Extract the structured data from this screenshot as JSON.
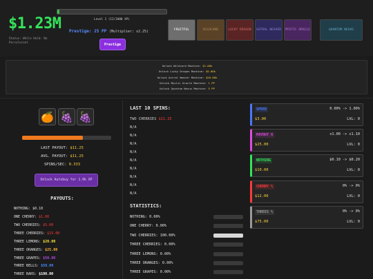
{
  "header": {
    "money": "$1.23M",
    "status": "Status: While Hold: No Parcolorant",
    "xp_fraction": 0.02,
    "level_label": "Level 1 (12/1000 XP)",
    "prestige_label": "Prestige: 25 PP",
    "prestige_mult": "(Multiplier: x2.25)",
    "prestige_button": "Prestige"
  },
  "tabs": [
    {
      "label": "FRUITFUL",
      "bg": "#6e6e6e",
      "fg": "#ffffff"
    },
    {
      "label": "WILDCARD",
      "bg": "#5a4226",
      "fg": "#b08a5a"
    },
    {
      "label": "LUCKY DRAGON",
      "bg": "#5a2424",
      "fg": "#d06a6a"
    },
    {
      "label": "ASTRAL WEAVER",
      "bg": "#2e2a5e",
      "fg": "#8a86d6"
    },
    {
      "label": "MYSTIC ORACLE",
      "bg": "#4a2660",
      "fg": "#b57ad6"
    },
    {
      "label": "QUANTUM NEXUS",
      "bg": "#1f3e4a",
      "fg": "#6aa8c0"
    }
  ],
  "unlocks": [
    {
      "text": "Unlock Wildcard Machine: ",
      "cost": "$1.00k"
    },
    {
      "text": "Unlock Lucky Dragon Machine: ",
      "cost": "$5.00k"
    },
    {
      "text": "Unlock Astral Weaver Machine: ",
      "cost": "$20.00k"
    },
    {
      "text": "Unlock Mystic Oracle Machine: ",
      "cost": "1 PP"
    },
    {
      "text": "Unlock Quantum Nexus Machine: ",
      "cost": "5 PP"
    }
  ],
  "reels": [
    "🍊",
    "🍇",
    "🍇"
  ],
  "spin_progress": 0.68,
  "stats": {
    "last_payout_label": "LAST PAYOUT: ",
    "last_payout": "$11.25",
    "avg_payout_label": "AVG. PAYOUT: ",
    "avg_payout": "$11.25",
    "spins_label": "SPINS/SEC: ",
    "spins": "0.333"
  },
  "autobuy_button": "Unlock Autobuy for 1.0k XP",
  "payouts": {
    "title": "PAYOUTS:",
    "rows": [
      {
        "label": "NOTHING: ",
        "value": "$0.10",
        "color": "#e6e6e6"
      },
      {
        "label": "ONE CHERRY: ",
        "value": "$1.00",
        "color": "#ff3b3b"
      },
      {
        "label": "TWO CHERRIES: ",
        "value": "$5.00",
        "color": "#ff3b3b"
      },
      {
        "label": "THREE CHERRIES: ",
        "value": "$15.00",
        "color": "#ff3b3b"
      },
      {
        "label": "THREE LEMONS: ",
        "value": "$20.00",
        "color": "#ffe63a"
      },
      {
        "label": "THREE ORANGES: ",
        "value": "$25.00",
        "color": "#ffb43a"
      },
      {
        "label": "THREE GRAPES: ",
        "value": "$50.00",
        "color": "#b24ae0"
      },
      {
        "label": "THREE BELLS: ",
        "value": "$50.00",
        "color": "#4a8cff"
      },
      {
        "label": "THREE BARS: ",
        "value": "$100.00",
        "color": "#ffffff"
      }
    ]
  },
  "last_spins": {
    "title": "LAST 10 SPINS:",
    "first_label": "TWO CHERRIES ",
    "first_value": "$11.25",
    "rest": [
      "N/A",
      "N/A",
      "N/A",
      "N/A",
      "N/A",
      "N/A",
      "N/A",
      "N/A",
      "N/A"
    ]
  },
  "statistics": {
    "title": "STATISTICS:",
    "rows": [
      {
        "label": "NOTHING: 0.00%",
        "fraction": 0.0
      },
      {
        "label": "ONE CHERRY: 0.00%",
        "fraction": 0.0
      },
      {
        "label": "TWO CHERRIES: 100.00%",
        "fraction": 1.0
      },
      {
        "label": "THREE CHERRIES: 0.00%",
        "fraction": 0.0
      },
      {
        "label": "THREE LEMONS: 0.00%",
        "fraction": 0.0
      },
      {
        "label": "THREE ORANGES: 0.00%",
        "fraction": 0.0
      },
      {
        "label": "THREE GRAPES: 0.00%",
        "fraction": 0.0
      }
    ]
  },
  "machines": [
    {
      "name": "SPEED",
      "rate": "0.00% -> 1.00%",
      "cost": "$3.00",
      "level": "LVL: 0",
      "color": "#4a78ff"
    },
    {
      "name": "PAYOUT X",
      "rate": "x1.00 -> x1.10",
      "cost": "$25.00",
      "level": "LVL: 0",
      "color": "#e04ae0"
    },
    {
      "name": "NOTHING",
      "rate": "$0.10 -> $0.20",
      "cost": "$10.00",
      "level": "LVL: 0",
      "color": "#35e35a"
    },
    {
      "name": "CHERRY %",
      "rate": "0% -> 0%",
      "cost": "$12.00",
      "level": "LVL: 0",
      "color": "#ff3b3b"
    },
    {
      "name": "THREES %",
      "rate": "0% -> 0%",
      "cost": "$75.00",
      "level": "LVL: 0",
      "color": "#9a9a9a"
    }
  ]
}
